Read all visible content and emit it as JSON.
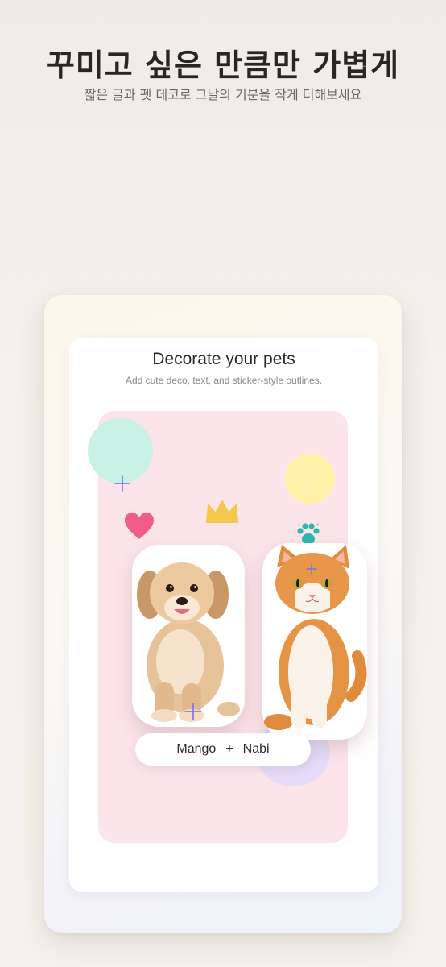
{
  "header": {
    "title": "꾸미고 싶은 만큼만 가볍게",
    "subtitle": "짧은 글과 펫 데코로 그날의 기분을 작게 더해보세요"
  },
  "card": {
    "title": "Decorate your pets",
    "subtitle": "Add cute deco, text, and sticker-style outlines."
  },
  "pets": {
    "name_left": "Mango",
    "separator": "+",
    "name_right": "Nabi"
  },
  "stickers": [
    "heart-icon",
    "crown-icon",
    "paw-icon",
    "sparkle-icon",
    "dog-photo",
    "cat-photo"
  ],
  "colors": {
    "background": "#f3efea",
    "stage": "#fbe4ea",
    "mint": "#c9f1e6",
    "yellow": "#fff1a8",
    "lilac": "#e4dcf8",
    "heart": "#f25c8c",
    "crown": "#f3c84b",
    "paw": "#2bb8b0",
    "sparkle": "#7b6fe0"
  }
}
